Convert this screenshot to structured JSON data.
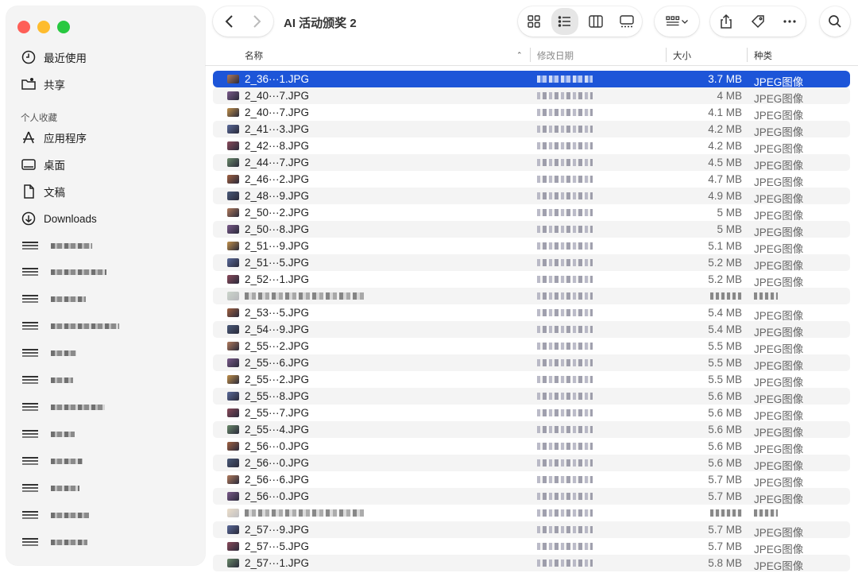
{
  "window": {
    "title": "AI 活动颁奖 2"
  },
  "sidebar": {
    "favorites_header": "个人收藏",
    "items_top": [
      {
        "label": "最近使用",
        "icon": "clock-icon"
      },
      {
        "label": "共享",
        "icon": "shared-folder-icon"
      }
    ],
    "favorites": [
      {
        "label": "应用程序",
        "icon": "applications-icon"
      },
      {
        "label": "桌面",
        "icon": "desktop-icon"
      },
      {
        "label": "文稿",
        "icon": "document-icon"
      },
      {
        "label": "Downloads",
        "icon": "download-icon"
      }
    ]
  },
  "columns": {
    "name": "名称",
    "modified": "修改日期",
    "size": "大小",
    "kind": "种类"
  },
  "files": [
    {
      "name": "2_36···1.JPG",
      "size": "3.7 MB",
      "kind": "JPEG图像",
      "selected": true
    },
    {
      "name": "2_40···7.JPG",
      "size": "4 MB",
      "kind": "JPEG图像"
    },
    {
      "name": "2_40···7.JPG",
      "size": "4.1 MB",
      "kind": "JPEG图像"
    },
    {
      "name": "2_41···3.JPG",
      "size": "4.2 MB",
      "kind": "JPEG图像"
    },
    {
      "name": "2_42···8.JPG",
      "size": "4.2 MB",
      "kind": "JPEG图像"
    },
    {
      "name": "2_44···7.JPG",
      "size": "4.5 MB",
      "kind": "JPEG图像"
    },
    {
      "name": "2_46···2.JPG",
      "size": "4.7 MB",
      "kind": "JPEG图像"
    },
    {
      "name": "2_48···9.JPG",
      "size": "4.9 MB",
      "kind": "JPEG图像"
    },
    {
      "name": "2_50···2.JPG",
      "size": "5 MB",
      "kind": "JPEG图像"
    },
    {
      "name": "2_50···8.JPG",
      "size": "5 MB",
      "kind": "JPEG图像"
    },
    {
      "name": "2_51···9.JPG",
      "size": "5.1 MB",
      "kind": "JPEG图像"
    },
    {
      "name": "2_51···5.JPG",
      "size": "5.2 MB",
      "kind": "JPEG图像"
    },
    {
      "name": "2_52···1.JPG",
      "size": "5.2 MB",
      "kind": "JPEG图像"
    },
    {
      "name": "",
      "size": "",
      "kind": "",
      "blurred": true
    },
    {
      "name": "2_53···5.JPG",
      "size": "5.4 MB",
      "kind": "JPEG图像"
    },
    {
      "name": "2_54···9.JPG",
      "size": "5.4 MB",
      "kind": "JPEG图像"
    },
    {
      "name": "2_55···2.JPG",
      "size": "5.5 MB",
      "kind": "JPEG图像"
    },
    {
      "name": "2_55···6.JPG",
      "size": "5.5 MB",
      "kind": "JPEG图像"
    },
    {
      "name": "2_55···2.JPG",
      "size": "5.5 MB",
      "kind": "JPEG图像"
    },
    {
      "name": "2_55···8.JPG",
      "size": "5.6 MB",
      "kind": "JPEG图像"
    },
    {
      "name": "2_55···7.JPG",
      "size": "5.6 MB",
      "kind": "JPEG图像"
    },
    {
      "name": "2_55···4.JPG",
      "size": "5.6 MB",
      "kind": "JPEG图像"
    },
    {
      "name": "2_56···0.JPG",
      "size": "5.6 MB",
      "kind": "JPEG图像"
    },
    {
      "name": "2_56···0.JPG",
      "size": "5.6 MB",
      "kind": "JPEG图像"
    },
    {
      "name": "2_56···6.JPG",
      "size": "5.7 MB",
      "kind": "JPEG图像"
    },
    {
      "name": "2_56···0.JPG",
      "size": "5.7 MB",
      "kind": "JPEG图像"
    },
    {
      "name": "",
      "size": "",
      "kind": "",
      "blurred": true
    },
    {
      "name": "2_57···9.JPG",
      "size": "5.7 MB",
      "kind": "JPEG图像"
    },
    {
      "name": "2_57···5.JPG",
      "size": "5.7 MB",
      "kind": "JPEG图像"
    },
    {
      "name": "2_57···1.JPG",
      "size": "5.8 MB",
      "kind": "JPEG图像"
    }
  ],
  "colors": {
    "selection": "#1d55d8"
  }
}
